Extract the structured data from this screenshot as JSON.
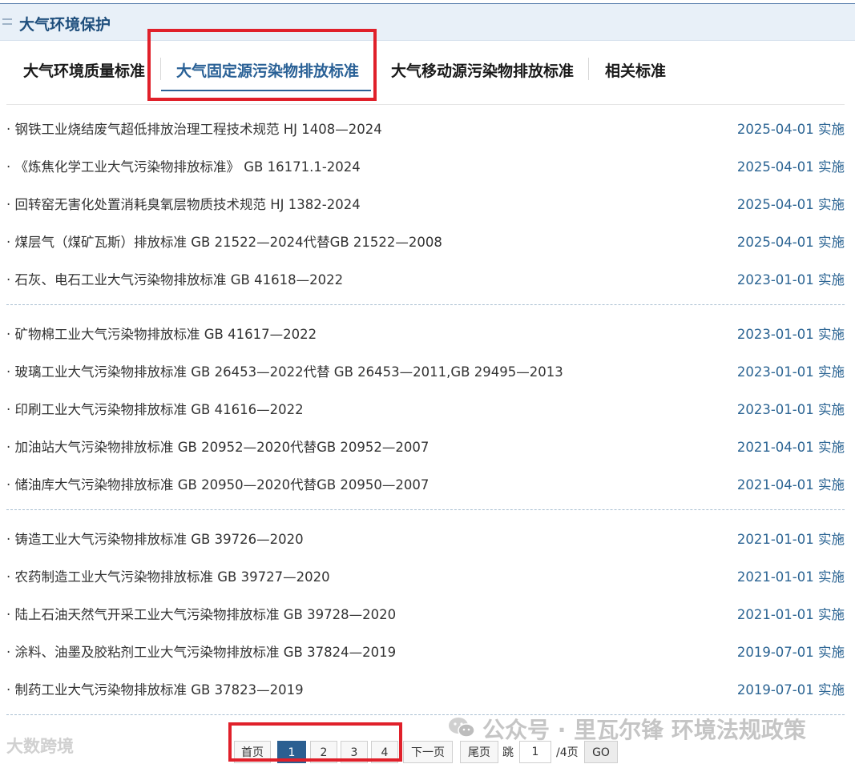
{
  "section": {
    "title": "大气环境保护"
  },
  "tabs": [
    {
      "label": "大气环境质量标准"
    },
    {
      "label": "大气固定源污染物排放标准"
    },
    {
      "label": "大气移动源污染物排放标准"
    },
    {
      "label": "相关标准"
    }
  ],
  "items": [
    {
      "title": "· 钢铁工业烧结废气超低排放治理工程技术规范 HJ 1408—2024",
      "date": "2025-04-01 实施"
    },
    {
      "title": "· 《炼焦化学工业大气污染物排放标准》 GB 16171.1-2024",
      "date": "2025-04-01 实施"
    },
    {
      "title": "· 回转窑无害化处置消耗臭氧层物质技术规范 HJ 1382-2024",
      "date": "2025-04-01 实施"
    },
    {
      "title": "· 煤层气（煤矿瓦斯）排放标准 GB 21522—2024代替GB 21522—2008",
      "date": "2025-04-01 实施"
    },
    {
      "title": "· 石灰、电石工业大气污染物排放标准 GB 41618—2022",
      "date": "2023-01-01 实施"
    },
    {
      "title": "· 矿物棉工业大气污染物排放标准 GB 41617—2022",
      "date": "2023-01-01 实施"
    },
    {
      "title": "· 玻璃工业大气污染物排放标准 GB 26453—2022代替 GB 26453—2011,GB 29495—2013",
      "date": "2023-01-01 实施"
    },
    {
      "title": "· 印刷工业大气污染物排放标准 GB 41616—2022",
      "date": "2023-01-01 实施"
    },
    {
      "title": "· 加油站大气污染物排放标准 GB 20952—2020代替GB 20952—2007",
      "date": "2021-04-01 实施"
    },
    {
      "title": "· 储油库大气污染物排放标准 GB 20950—2020代替GB 20950—2007",
      "date": "2021-04-01 实施"
    },
    {
      "title": "· 铸造工业大气污染物排放标准 GB 39726—2020",
      "date": "2021-01-01 实施"
    },
    {
      "title": "· 农药制造工业大气污染物排放标准 GB 39727—2020",
      "date": "2021-01-01 实施"
    },
    {
      "title": "· 陆上石油天然气开采工业大气污染物排放标准 GB 39728—2020",
      "date": "2021-01-01 实施"
    },
    {
      "title": "· 涂料、油墨及胶粘剂工业大气污染物排放标准 GB 37824—2019",
      "date": "2019-07-01 实施"
    },
    {
      "title": "· 制药工业大气污染物排放标准 GB 37823—2019",
      "date": "2019-07-01 实施"
    }
  ],
  "pagination": {
    "first": "首页",
    "pages": [
      "1",
      "2",
      "3",
      "4"
    ],
    "current": "1",
    "next": "下一页",
    "last": "尾页",
    "jump_label": "跳",
    "jump_value": "1",
    "total": "/4页",
    "go": "GO"
  },
  "watermarks": {
    "wechat": "公众号 · 里瓦尔锋 环境法规政策",
    "corner": "大数跨境"
  },
  "icons": {
    "wechat_logo": "wechat-icon",
    "header_mark": "list-icon"
  },
  "colors": {
    "accent": "#2a6196",
    "date": "#2b6493",
    "highlight": "#e0202a",
    "header_bg": "#e8f0f8"
  }
}
